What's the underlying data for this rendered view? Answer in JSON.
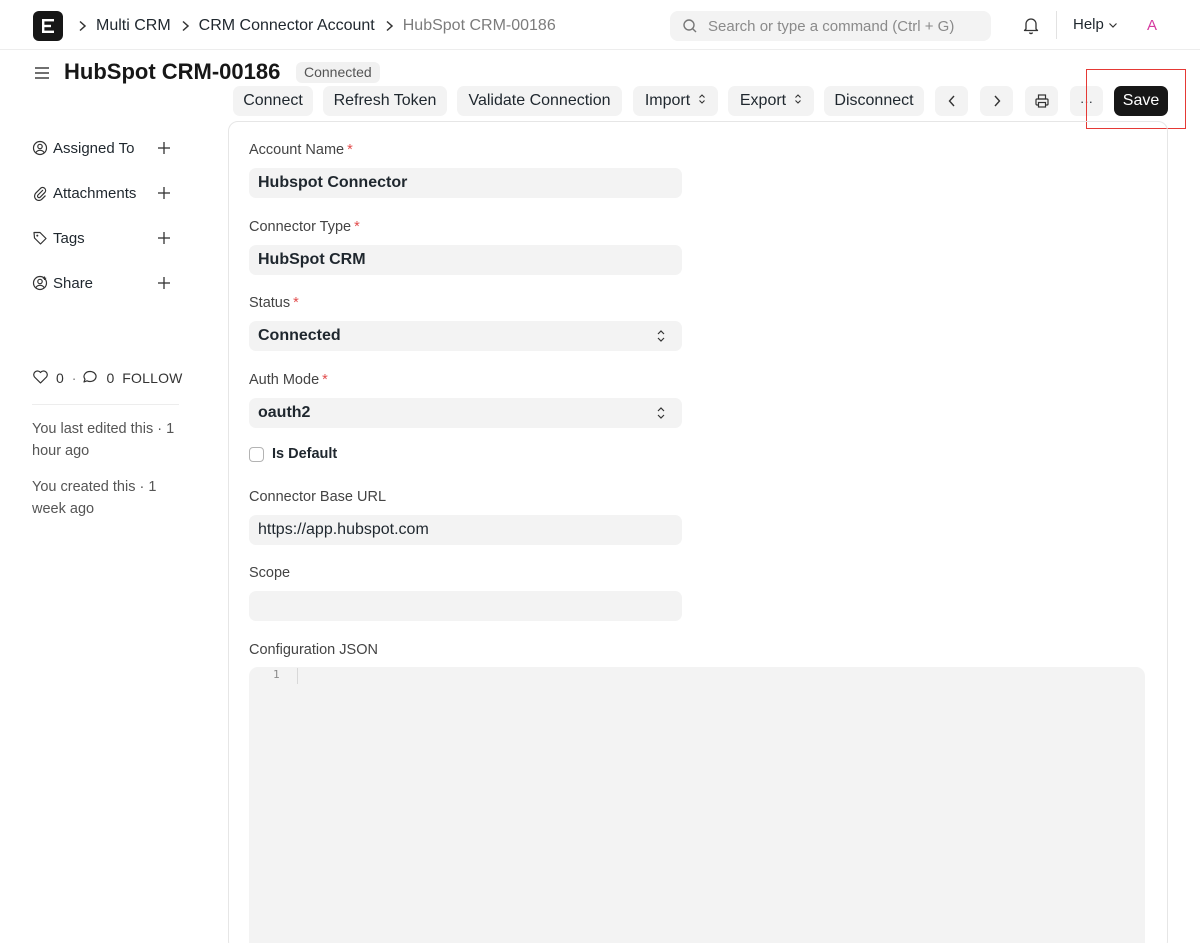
{
  "navbar": {
    "breadcrumbs": [
      "Multi CRM",
      "CRM Connector Account",
      "HubSpot CRM-00186"
    ],
    "search_placeholder": "Search or type a command (Ctrl + G)",
    "help_label": "Help",
    "avatar_initial": "A"
  },
  "page": {
    "title": "HubSpot CRM-00186",
    "status_badge": "Connected"
  },
  "toolbar": {
    "connect": "Connect",
    "refresh_token": "Refresh Token",
    "validate_connection": "Validate Connection",
    "import": "Import",
    "export": "Export",
    "disconnect": "Disconnect",
    "more": "···",
    "save": "Save"
  },
  "sidebar": {
    "items": [
      {
        "label": "Assigned To",
        "icon": "user-circle-icon"
      },
      {
        "label": "Attachments",
        "icon": "paperclip-icon"
      },
      {
        "label": "Tags",
        "icon": "tag-icon"
      },
      {
        "label": "Share",
        "icon": "share-user-icon"
      }
    ],
    "likes": "0",
    "comments": "0",
    "follow_label": "FOLLOW",
    "timeline": [
      "You last edited this · 1 hour ago",
      "You created this · 1 week ago"
    ]
  },
  "form": {
    "account_name": {
      "label": "Account Name",
      "value": "Hubspot Connector"
    },
    "connector_type": {
      "label": "Connector Type",
      "value": "HubSpot CRM"
    },
    "status": {
      "label": "Status",
      "value": "Connected"
    },
    "auth_mode": {
      "label": "Auth Mode",
      "value": "oauth2"
    },
    "is_default": {
      "label": "Is Default",
      "checked": false
    },
    "connector_base_url": {
      "label": "Connector Base URL",
      "value": "https://app.hubspot.com"
    },
    "scope": {
      "label": "Scope",
      "value": ""
    },
    "configuration_json": {
      "label": "Configuration JSON",
      "line_number": "1"
    }
  },
  "colors": {
    "accent": "#171717",
    "required": "#e24c4c",
    "highlight": "#e53935"
  }
}
